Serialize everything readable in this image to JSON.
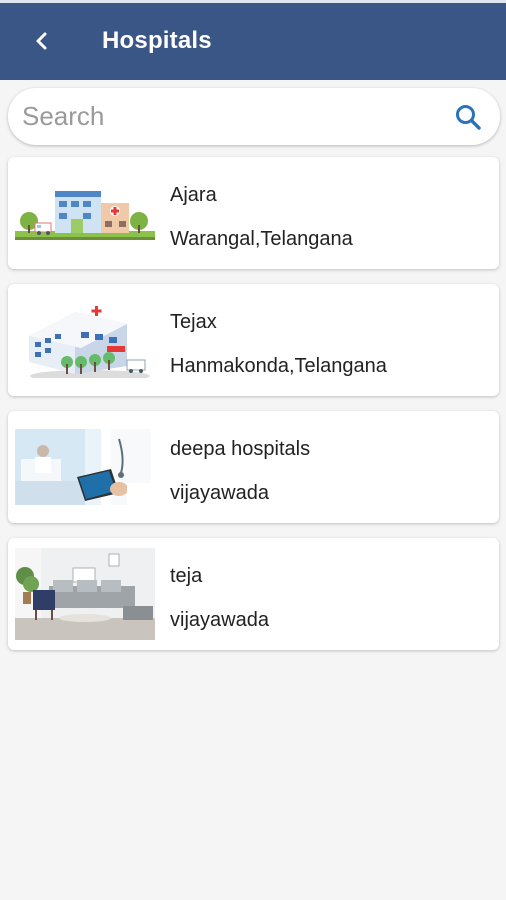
{
  "header": {
    "title": "Hospitals",
    "back_icon": "chevron-left-icon",
    "background_color": "#3a5687"
  },
  "search": {
    "placeholder": "Search",
    "value": "",
    "icon": "search-icon",
    "icon_color": "#2a73b8"
  },
  "hospitals": [
    {
      "name": "Ajara",
      "location": "Warangal,Telangana",
      "image": "hospital-building-illustration"
    },
    {
      "name": "Tejax",
      "location": "Hanmakonda,Telangana",
      "image": "hospital-3d-building"
    },
    {
      "name": "deepa hospitals",
      "location": "vijayawada",
      "image": "doctor-with-tablet-photo"
    },
    {
      "name": "teja",
      "location": "vijayawada",
      "image": "living-room-interior-photo"
    }
  ]
}
